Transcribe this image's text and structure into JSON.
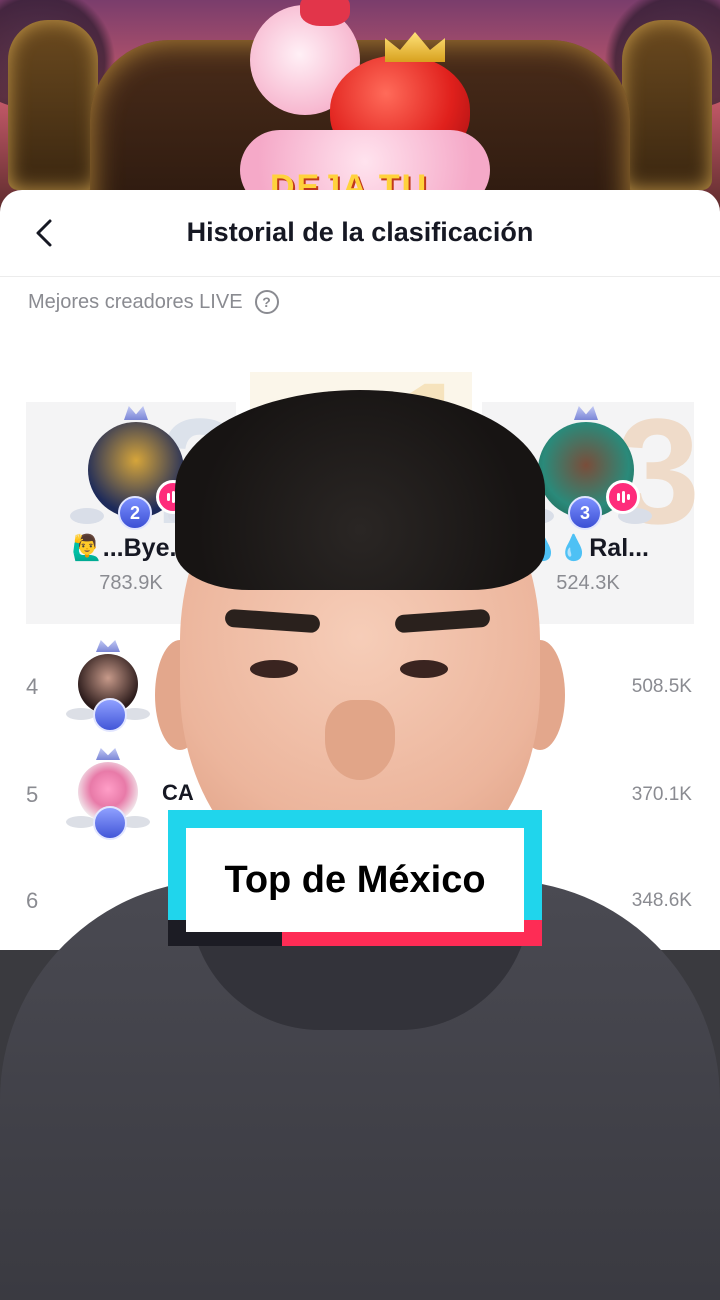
{
  "header": {
    "title": "Historial de la clasificación"
  },
  "section": {
    "label": "Mejores creadores LIVE"
  },
  "podium": {
    "first": {
      "rank": "1"
    },
    "second": {
      "rank": "2",
      "name": "🙋‍♂️...Bye...",
      "score": "783.9K"
    },
    "third": {
      "rank": "3",
      "name": "💧💧Ral...",
      "score": "524.3K"
    }
  },
  "rows": [
    {
      "rank": "4",
      "name": "",
      "score": "508.5K"
    },
    {
      "rank": "5",
      "name": "CA",
      "score": "370.1K"
    },
    {
      "rank": "6",
      "name": "",
      "score": "348.6K"
    }
  ],
  "banner": {
    "partial_text": "DEJA TU"
  },
  "caption": {
    "text": "Top de México"
  },
  "icons": {
    "back": "chevron-left-icon",
    "help": "question-circle-icon",
    "live": "live-indicator-icon"
  },
  "colors": {
    "live_pink": "#fe2c7b",
    "caption_cyan": "#20d5ec",
    "caption_red": "#fe2c55"
  }
}
